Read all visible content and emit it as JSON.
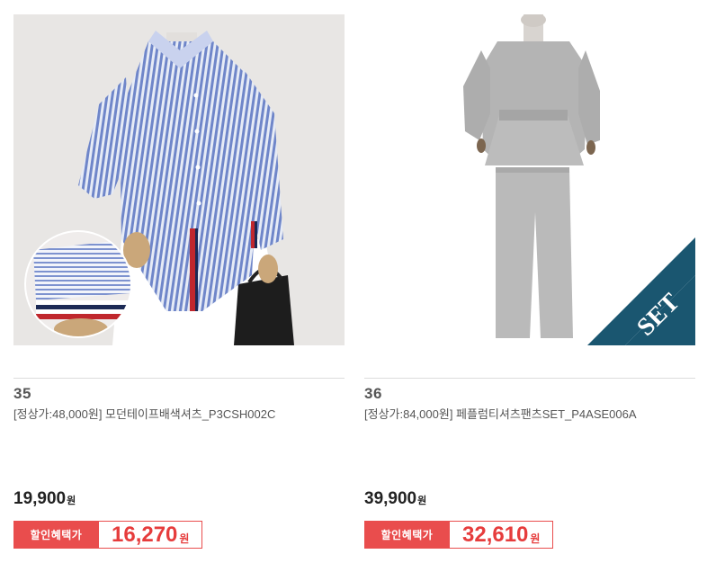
{
  "products": [
    {
      "number": "35",
      "title": "[정상가:48,000원] 모던테이프배색셔츠_P3CSH002C",
      "price": "19,900",
      "price_unit": "원",
      "sale_label": "할인혜택가",
      "sale_price": "16,270",
      "sale_unit": "원",
      "image": "striped-shirt-photo"
    },
    {
      "number": "36",
      "title": "[정상가:84,000원] 페플럼티셔츠팬츠SET_P4ASE006A",
      "price": "39,900",
      "price_unit": "원",
      "sale_label": "할인혜택가",
      "sale_price": "32,610",
      "sale_unit": "원",
      "image": "gray-sweat-set-photo",
      "badge": "SET"
    }
  ],
  "colors": {
    "sale_red": "#e94d4d",
    "set_badge": "#1a5670"
  }
}
